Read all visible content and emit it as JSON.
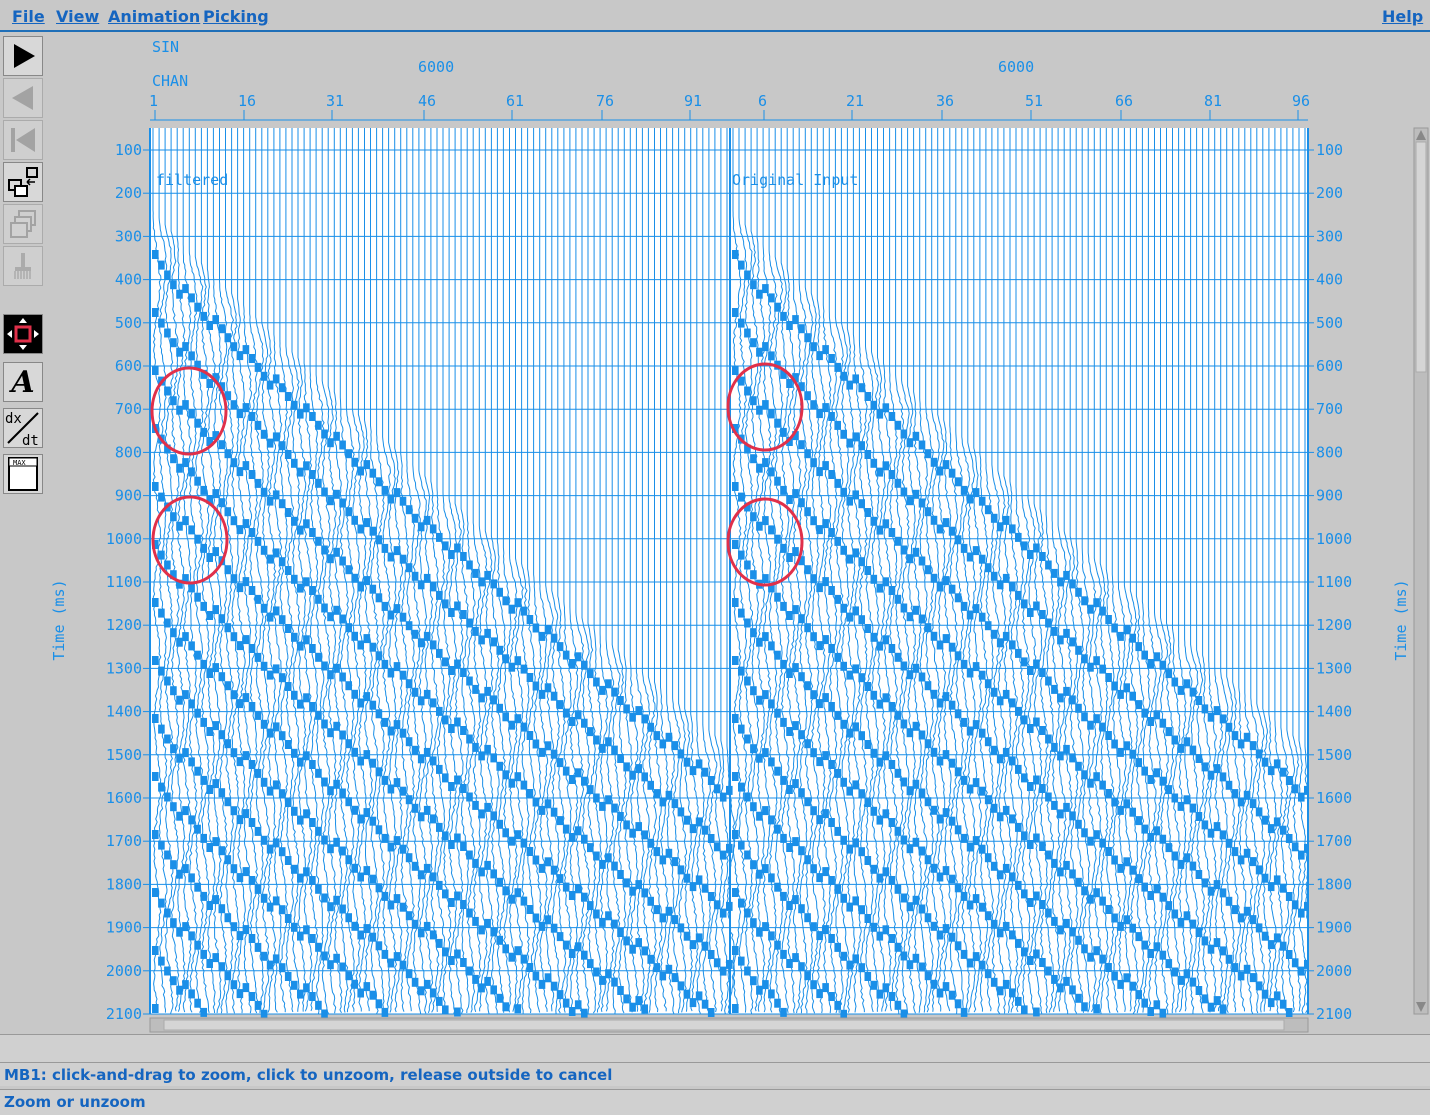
{
  "menu": {
    "file": "File",
    "view": "View",
    "animation": "Animation",
    "picking": "Picking",
    "help": "Help"
  },
  "toolbar": {
    "tools": [
      {
        "icon": "play-forward-icon",
        "enabled": true
      },
      {
        "icon": "play-backward-icon",
        "enabled": false
      },
      {
        "icon": "rewind-icon",
        "enabled": false
      },
      {
        "icon": "window-swap-icon",
        "enabled": true
      },
      {
        "icon": "window-stack-icon",
        "enabled": false
      },
      {
        "icon": "brush-icon",
        "enabled": false
      },
      {
        "icon": "zoom-move-icon",
        "enabled": true
      },
      {
        "icon": "annotate-text-icon",
        "enabled": true
      },
      {
        "icon": "dx-dt-icon",
        "enabled": true
      },
      {
        "icon": "max-icon",
        "enabled": true
      }
    ],
    "annotate_glyph": "A",
    "max_label": "MAX"
  },
  "header": {
    "sin_label": "SIN",
    "chan_label": "CHAN",
    "panel_values": [
      "6000",
      "6000"
    ],
    "left_chan_ticks": [
      "1",
      "16",
      "31",
      "46",
      "61",
      "76",
      "91"
    ],
    "right_chan_ticks": [
      "6",
      "21",
      "36",
      "51",
      "66",
      "81",
      "96"
    ]
  },
  "axis": {
    "left_label": "Time (ms)",
    "right_label": "Time (ms)",
    "time_ticks": [
      "100",
      "200",
      "300",
      "400",
      "500",
      "600",
      "700",
      "800",
      "900",
      "1000",
      "1100",
      "1200",
      "1300",
      "1400",
      "1500",
      "1600",
      "1700",
      "1800",
      "1900",
      "2000",
      "2100"
    ]
  },
  "panels": {
    "left_title": "filtered",
    "right_title": "Original Input"
  },
  "colors": {
    "trace": "#1a8fe8",
    "annotation": "#e0304a",
    "text": "#1565c0"
  },
  "status": {
    "mb1_hint": "MB1: click-and-drag to zoom, click to unzoom, release outside to cancel",
    "mode": "Zoom or unzoom"
  }
}
